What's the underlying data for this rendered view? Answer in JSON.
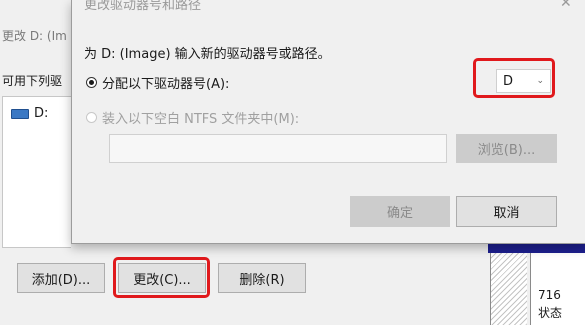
{
  "background_dialog": {
    "subtitle": "更改 D: (Im",
    "list_label": "可用下列驱",
    "drive_item": "D:",
    "buttons": {
      "add": "添加(D)...",
      "change": "更改(C)...",
      "delete": "删除(R)"
    },
    "disk_map": {
      "size_text": "716",
      "status_text": "状态"
    }
  },
  "modal": {
    "title": "更改驱动器号和路径",
    "close_glyph": "✕",
    "prompt": "为 D: (Image) 输入新的驱动器号或路径。",
    "option_assign": {
      "label": "分配以下驱动器号(A):",
      "checked": true
    },
    "drive_letter": {
      "selected": "D",
      "arrow_glyph": "⌄"
    },
    "option_mount": {
      "label": "装入以下空白 NTFS 文件夹中(M):",
      "checked": false,
      "enabled": false
    },
    "path_input": {
      "value": ""
    },
    "browse_label": "浏览(B)...",
    "ok_label": "确定",
    "cancel_label": "取消"
  },
  "colors": {
    "highlight_red": "#e0191c",
    "drive_icon_blue": "#3a78c4",
    "disk_map_bar": "#1d1f8e"
  }
}
